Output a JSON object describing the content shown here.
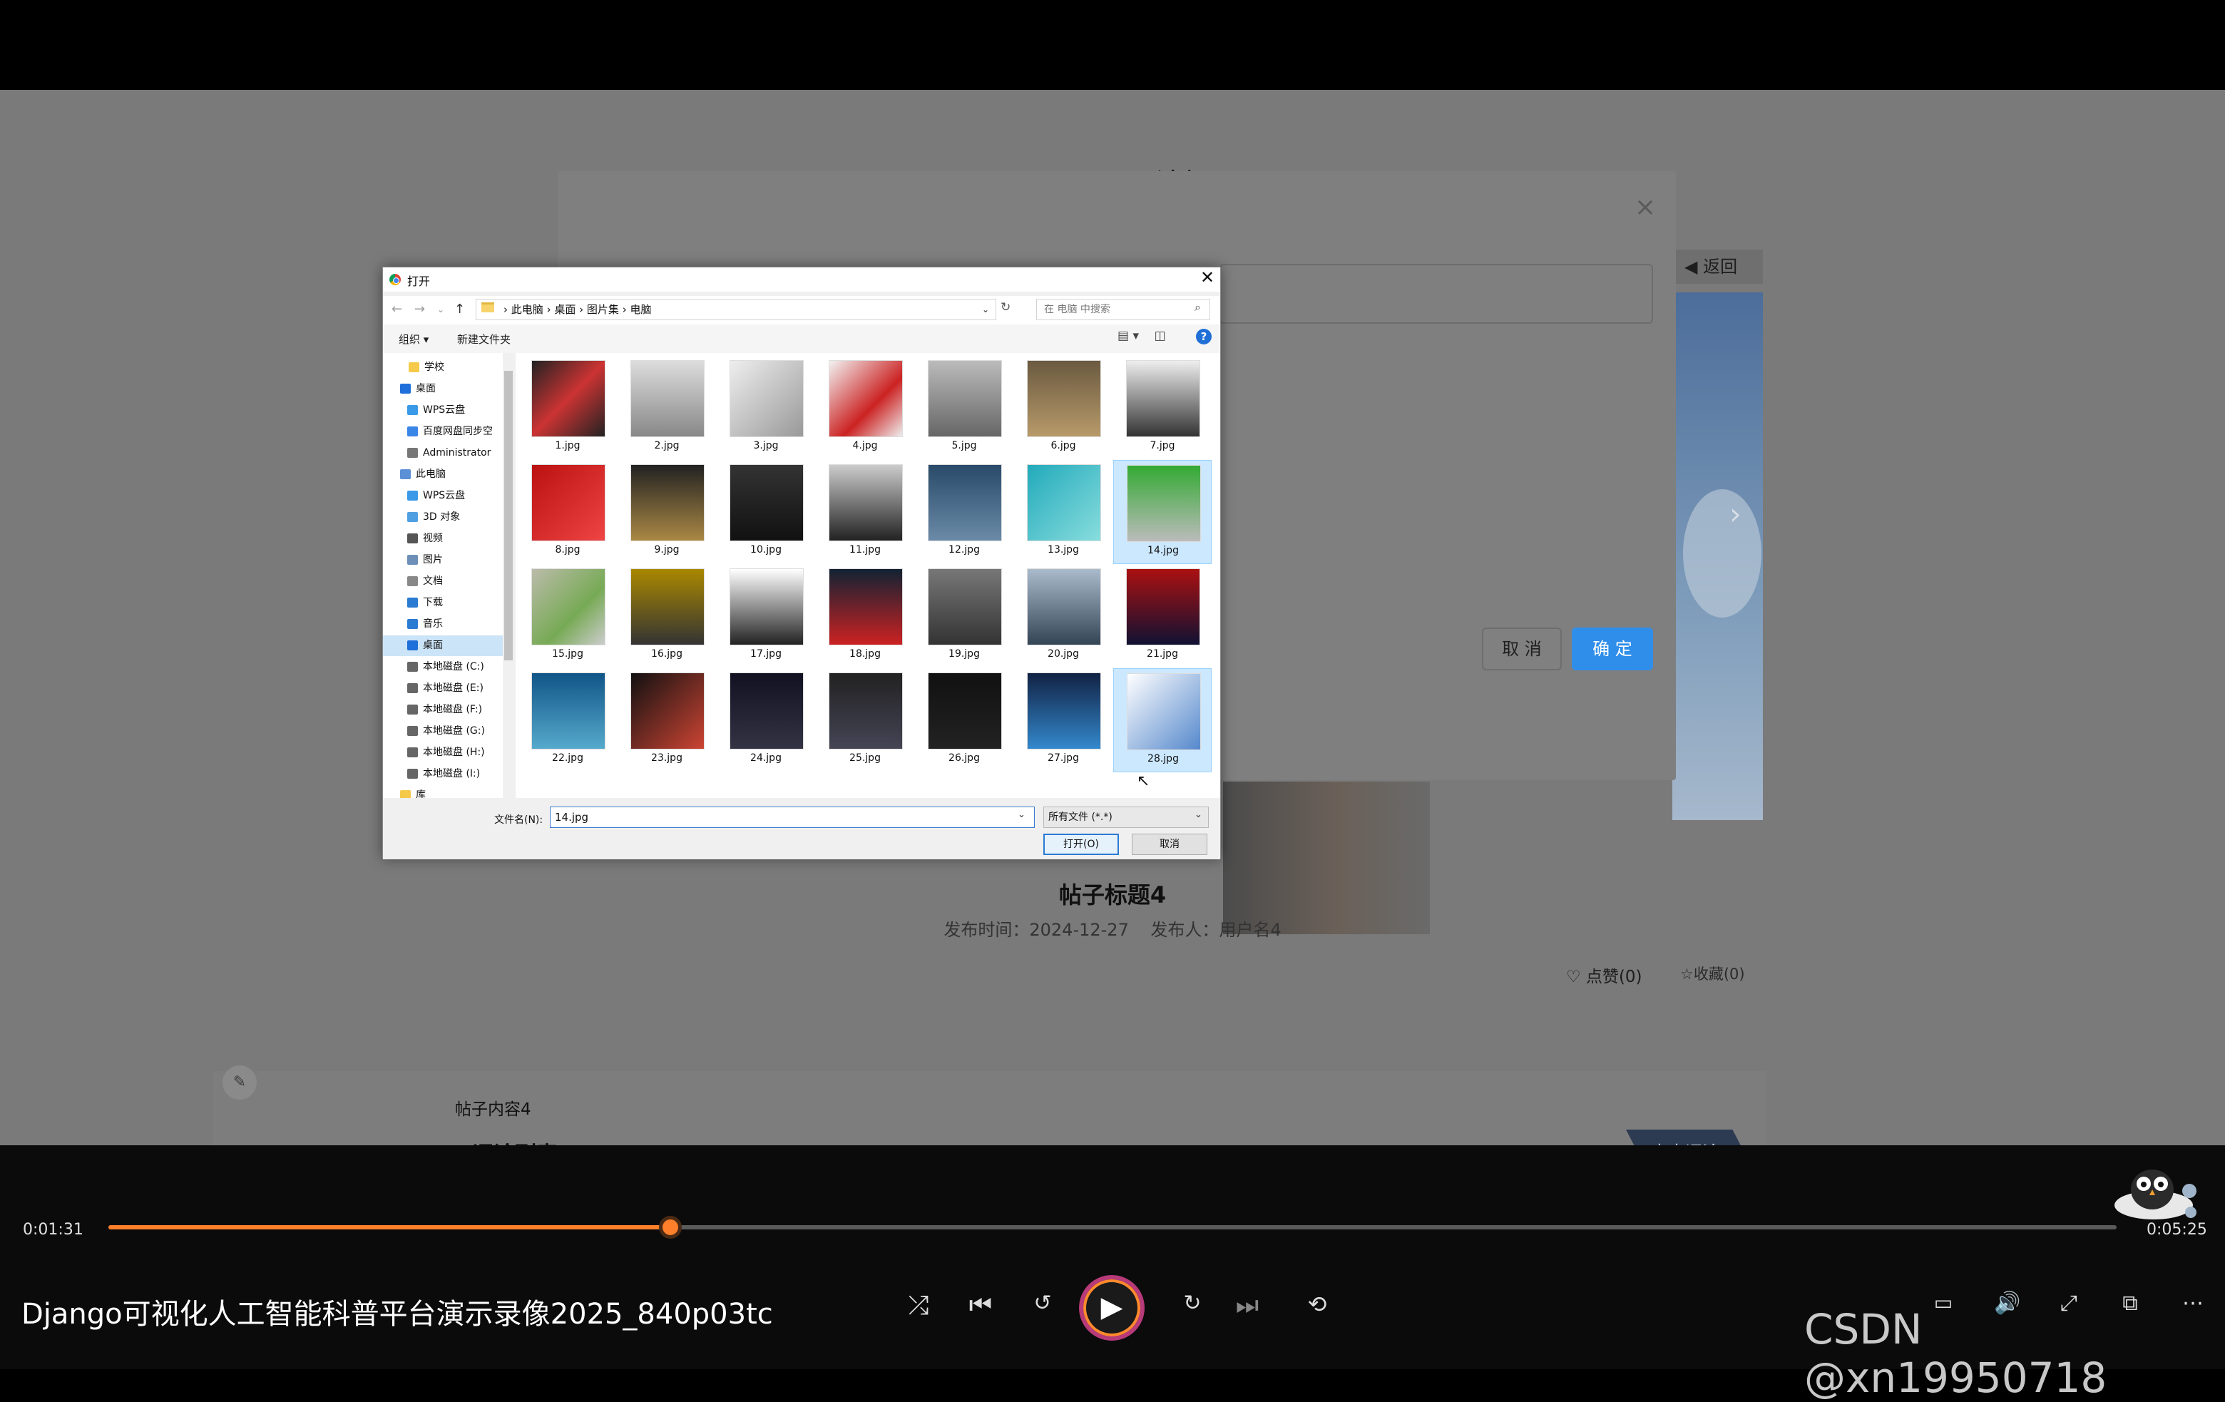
{
  "forum": {
    "title": "论坛",
    "back_label": "返回",
    "post_title": "帖子标题4",
    "publish_label": "发布时间：",
    "publish_date": "2024-12-27",
    "publisher_label": "发布人：",
    "publisher": "用户名4",
    "like": "点赞(0)",
    "favorite": "收藏(0)",
    "content": "帖子内容4",
    "comments_title": "评论列表",
    "comment_button": "点击评论"
  },
  "modal": {
    "close": "×",
    "cancel": "取 消",
    "confirm": "确 定"
  },
  "file_dialog": {
    "title": "打开",
    "close": "✕",
    "breadcrumb": [
      "此电脑",
      "桌面",
      "图片集",
      "电脑"
    ],
    "search_placeholder": "在 电脑 中搜索",
    "organize": "组织 ▾",
    "new_folder": "新建文件夹",
    "tree": [
      "学校",
      "桌面",
      "WPS云盘",
      "百度网盘同步空",
      "Administrator",
      "此电脑",
      "WPS云盘",
      "3D 对象",
      "视频",
      "图片",
      "文档",
      "下载",
      "音乐",
      "桌面",
      "本地磁盘 (C:)",
      "本地磁盘 (E:)",
      "本地磁盘 (F:)",
      "本地磁盘 (G:)",
      "本地磁盘 (H:)",
      "本地磁盘 (I:)",
      "库"
    ],
    "files": [
      "1.jpg",
      "2.jpg",
      "3.jpg",
      "4.jpg",
      "5.jpg",
      "6.jpg",
      "7.jpg",
      "8.jpg",
      "9.jpg",
      "10.jpg",
      "11.jpg",
      "12.jpg",
      "13.jpg",
      "14.jpg",
      "15.jpg",
      "16.jpg",
      "17.jpg",
      "18.jpg",
      "19.jpg",
      "20.jpg",
      "21.jpg",
      "22.jpg",
      "23.jpg",
      "24.jpg",
      "25.jpg",
      "26.jpg",
      "27.jpg",
      "28.jpg"
    ],
    "filename_label": "文件名(N):",
    "filename_value": "14.jpg",
    "filetype": "所有文件 (*.*)",
    "open": "打开(O)",
    "cancel": "取消"
  },
  "player": {
    "current_time": "0:01:31",
    "total_time": "0:05:25",
    "progress": 0.28,
    "video_title": "Django可视化人工智能科普平台演示录像2025_840p03tc",
    "watermark": "CSDN @xn19950718",
    "accent": "#ff7f2a"
  }
}
